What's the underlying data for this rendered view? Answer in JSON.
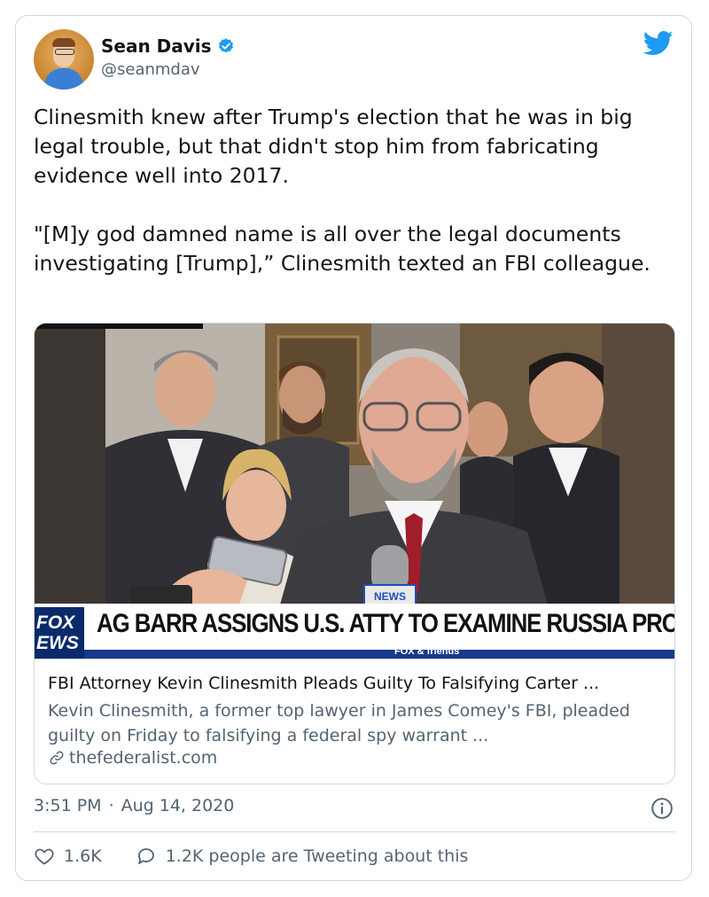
{
  "author": {
    "name": "Sean Davis",
    "handle": "@seanmdav"
  },
  "tweet": {
    "text": "Clinesmith knew after Trump's election that he was in big legal trouble, but that didn't stop him from fabricating evidence well into 2017.\n\n\"[M]y god damned name is all over the legal documents investigating [Trump],” Clinesmith texted an FBI colleague."
  },
  "link_card": {
    "image_logo_line1": "FOX",
    "image_logo_line2": "EWS",
    "image_headline": "AG BARR ASSIGNS U.S. ATTY TO EXAMINE RUSSIA PROB",
    "image_subbar": "FOX & friends",
    "image_mic_label": "NEWS",
    "title": "FBI Attorney Kevin Clinesmith Pleads Guilty To Falsifying Carter ...",
    "description": "Kevin Clinesmith, a former top lawyer in James Comey's FBI, pleaded guilty on Friday to falsifying a federal spy warrant ...",
    "domain": "thefederalist.com"
  },
  "meta": {
    "time": "3:51 PM",
    "separator": "·",
    "date": "Aug 14, 2020"
  },
  "actions": {
    "likes": "1.6K",
    "replies_text": "1.2K people are Tweeting about this"
  },
  "icons": [
    "verified-badge-icon",
    "twitter-bird-icon",
    "link-icon",
    "info-icon",
    "heart-icon",
    "reply-bubble-icon"
  ],
  "colors": {
    "twitter_blue": "#1d9bf0",
    "secondary_text": "#536471",
    "fox_navy": "#0a2a6b"
  }
}
